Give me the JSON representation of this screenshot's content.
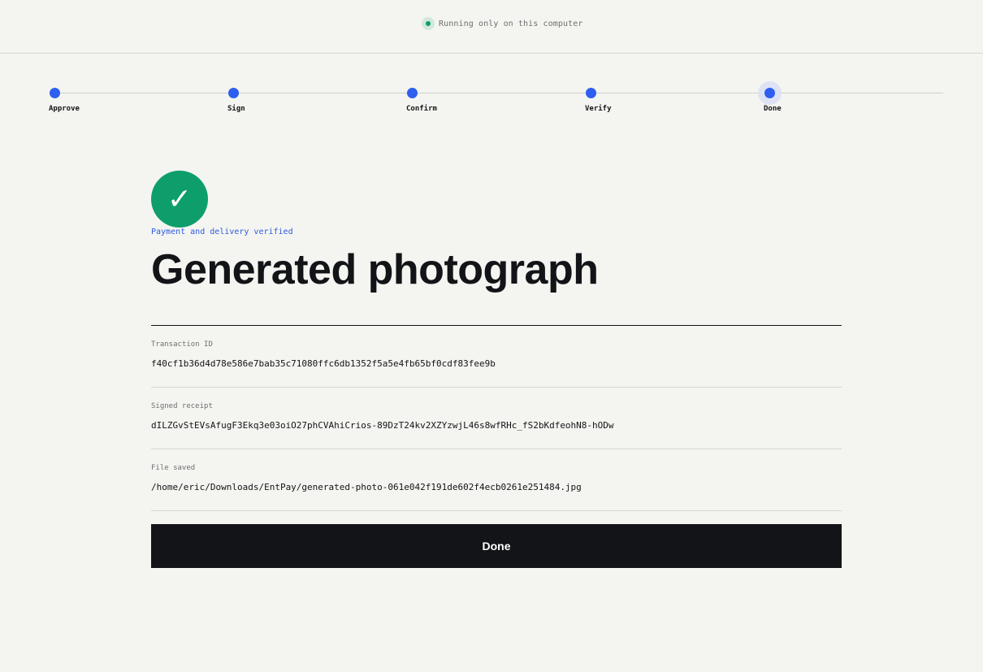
{
  "header": {
    "status_text": "Running only on this computer",
    "status_color": "#0f9b63"
  },
  "stepper": {
    "steps": [
      {
        "label": "Approve",
        "state": "complete"
      },
      {
        "label": "Sign",
        "state": "complete"
      },
      {
        "label": "Confirm",
        "state": "complete"
      },
      {
        "label": "Verify",
        "state": "complete"
      },
      {
        "label": "Done",
        "state": "current"
      }
    ],
    "accent_color": "#2f5ff0"
  },
  "result": {
    "icon": "check-icon",
    "icon_glyph": "✓",
    "success_color": "#0d9e6c",
    "verified_text": "Payment and delivery verified",
    "title": "Generated photograph"
  },
  "details": {
    "transaction_id_label": "Transaction ID",
    "transaction_id_value": "f40cf1b36d4d78e586e7bab35c71080ffc6db1352f5a5e4fb65bf0cdf83fee9b",
    "receipt_label": "Signed receipt",
    "receipt_value": "dILZGvStEVsAfugF3Ekq3e03oiO27phCVAhiCrios-89DzT24kv2XZYzwjL46s8wfRHc_fS2bKdfeohN8-hODw",
    "file_label": "File saved",
    "file_value": "/home/eric/Downloads/EntPay/generated-photo-061e042f191de602f4ecb0261e251484.jpg"
  },
  "actions": {
    "done_label": "Done"
  }
}
